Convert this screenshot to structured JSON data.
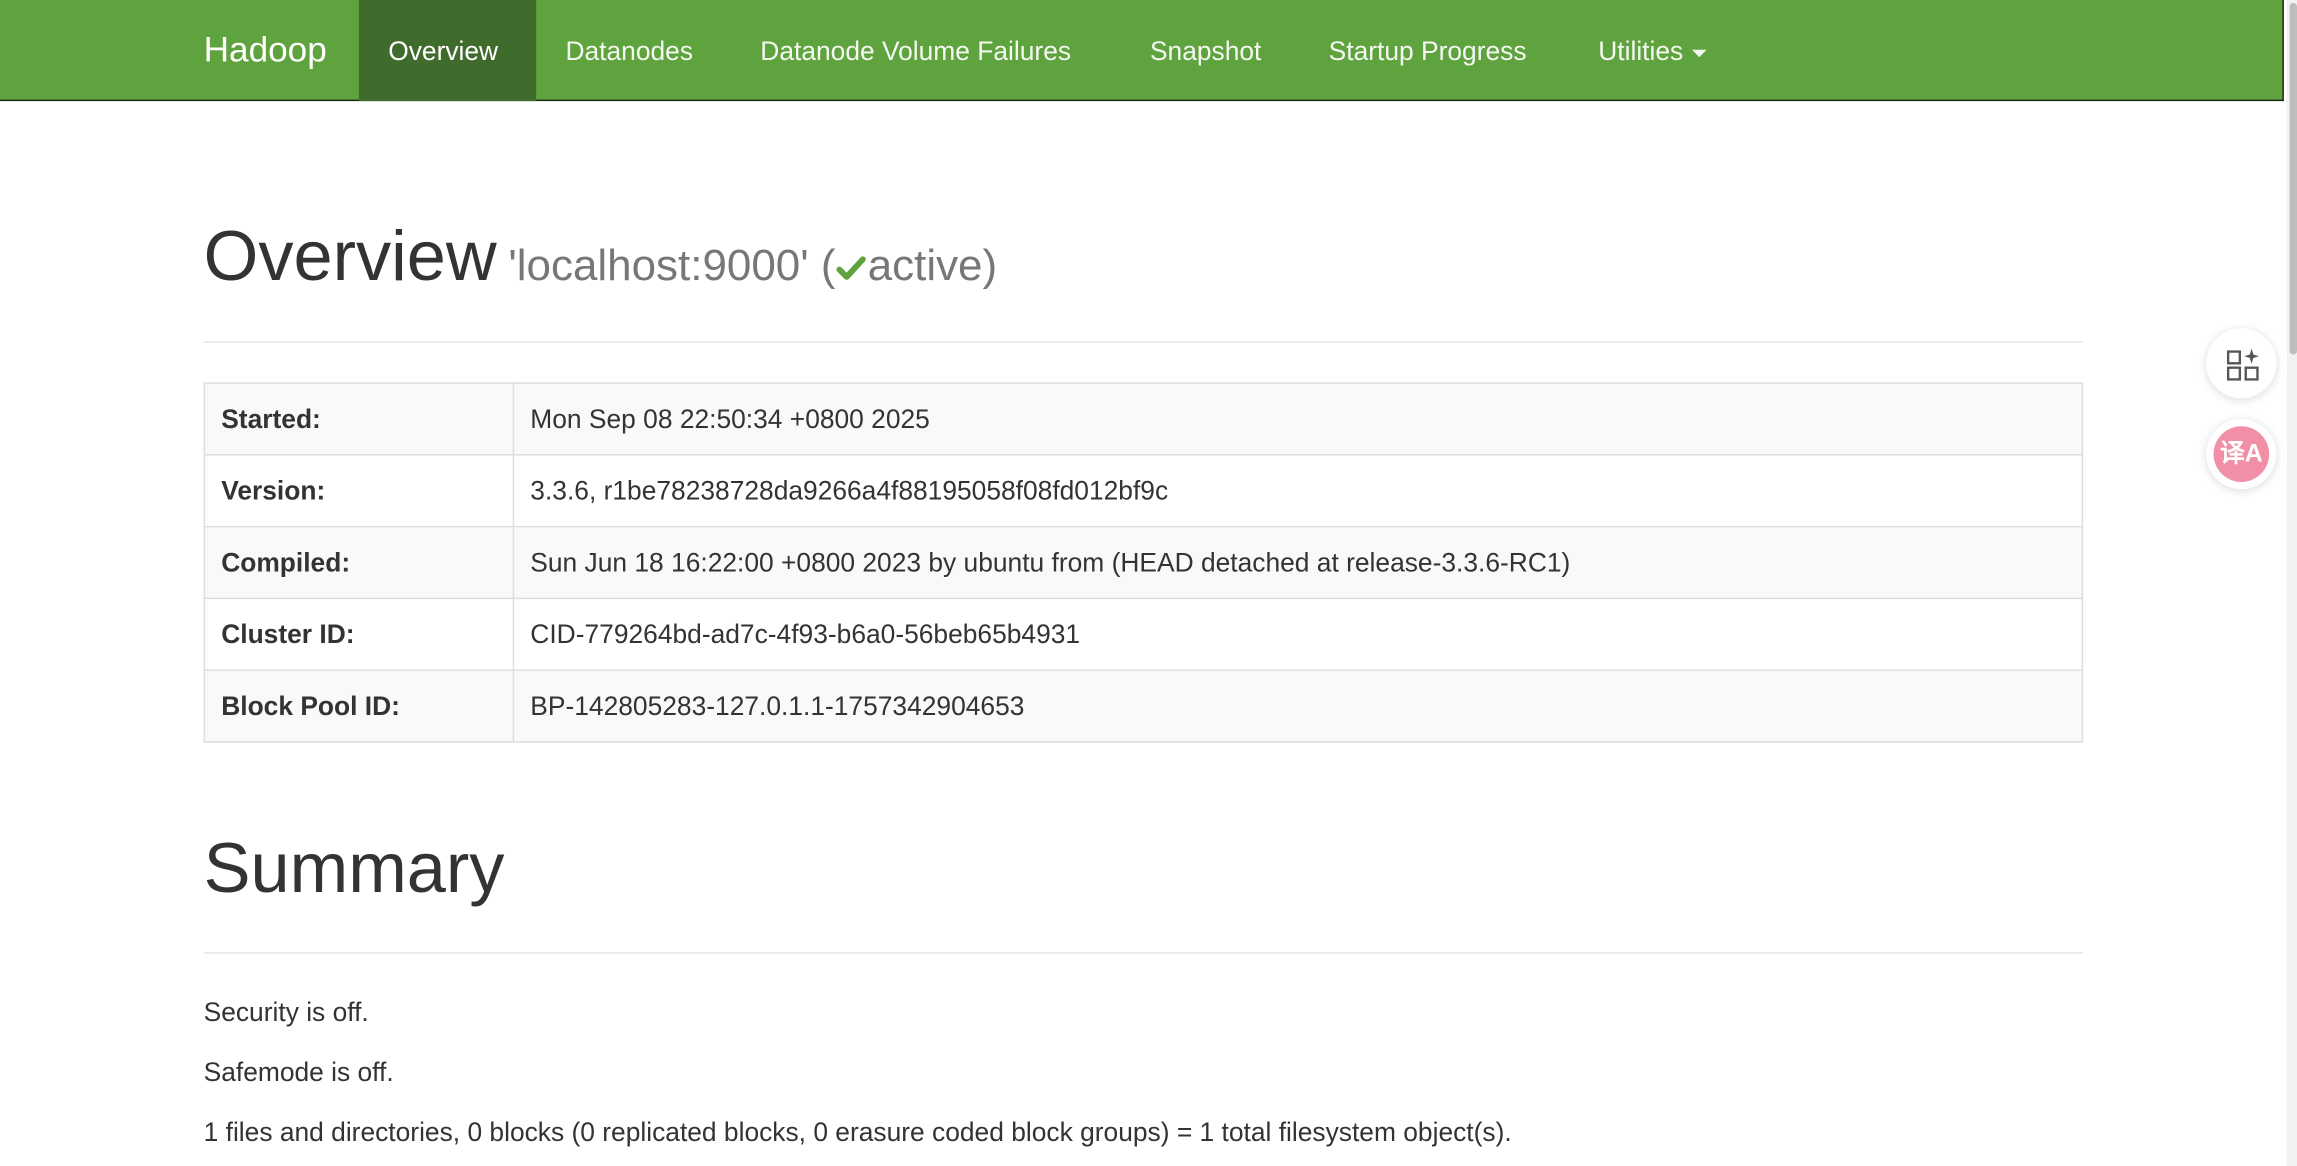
{
  "navbar": {
    "brand": "Hadoop",
    "items": [
      {
        "label": "Overview",
        "active": true
      },
      {
        "label": "Datanodes"
      },
      {
        "label": "Datanode Volume Failures"
      },
      {
        "label": "Snapshot"
      },
      {
        "label": "Startup Progress"
      },
      {
        "label": "Utilities"
      }
    ],
    "colors": {
      "bar": "#5fa33e",
      "active": "#3f6b2c"
    }
  },
  "overview": {
    "title": "Overview",
    "host": "'localhost:9000' (",
    "status": "active",
    "status_close": ")",
    "rows": [
      {
        "label": "Started:",
        "value": "Mon Sep 08 22:50:34 +0800 2025"
      },
      {
        "label": "Version:",
        "value": "3.3.6, r1be78238728da9266a4f88195058f08fd012bf9c"
      },
      {
        "label": "Compiled:",
        "value": "Sun Jun 18 16:22:00 +0800 2023 by ubuntu from (HEAD detached at release-3.3.6-RC1)"
      },
      {
        "label": "Cluster ID:",
        "value": "CID-779264bd-ad7c-4f93-b6a0-56beb65b4931"
      },
      {
        "label": "Block Pool ID:",
        "value": "BP-142805283-127.0.1.1-1757342904653"
      }
    ]
  },
  "summary": {
    "title": "Summary",
    "lines": [
      "Security is off.",
      "Safemode is off.",
      "1 files and directories, 0 blocks (0 replicated blocks, 0 erasure coded block groups) = 1 total filesystem object(s)."
    ]
  },
  "floating": {
    "translate_glyph": "译A"
  }
}
